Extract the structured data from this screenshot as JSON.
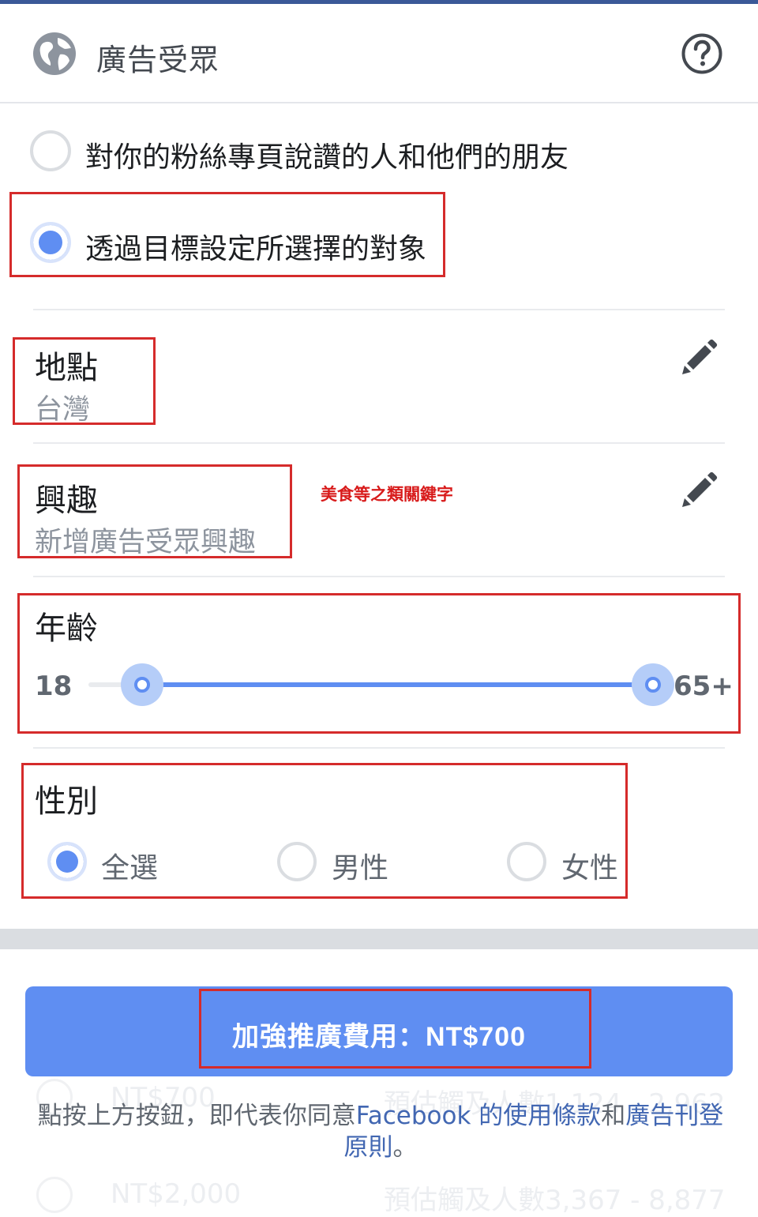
{
  "colors": {
    "accent": "#5f8ef2",
    "link": "#4267b2",
    "annotation_red": "#d52b2b",
    "top_strip": "#3b5998"
  },
  "header": {
    "icon": "globe-icon",
    "title": "廣告受眾",
    "help_icon": "help-circle-icon"
  },
  "audience_options": [
    {
      "label": "對你的粉絲專頁說讚的人和他們的朋友",
      "selected": false
    },
    {
      "label": "透過目標設定所選擇的對象",
      "selected": true
    }
  ],
  "location": {
    "title": "地點",
    "value": "台灣",
    "edit_icon": "pencil-icon"
  },
  "interests": {
    "title": "興趣",
    "placeholder": "新增廣告受眾興趣",
    "edit_icon": "pencil-icon",
    "annotation": "美食等之類關鍵字"
  },
  "age": {
    "title": "年齡",
    "min_label": "18",
    "max_label": "65+",
    "range_min": 18,
    "range_max": 65,
    "selected_min": 18,
    "selected_max": 65
  },
  "gender": {
    "title": "性別",
    "options": [
      {
        "label": "全選",
        "selected": true
      },
      {
        "label": "男性",
        "selected": false
      },
      {
        "label": "女性",
        "selected": false
      }
    ]
  },
  "budget_ghost": {
    "rows": [
      {
        "price": "NT$700",
        "reach": "預估觸及人數1,124 - 2,962"
      },
      {
        "price": "NT$2,000",
        "reach": "預估觸及人數3,367 - 8,877"
      }
    ]
  },
  "boost_button": {
    "label": "加強推廣費用：NT$700"
  },
  "terms": {
    "prefix": "點按上方按鈕，即代表你同意",
    "link1": "Facebook 的使用條款",
    "middle": "和",
    "link2": "廣告刊登原則",
    "suffix": "。"
  }
}
